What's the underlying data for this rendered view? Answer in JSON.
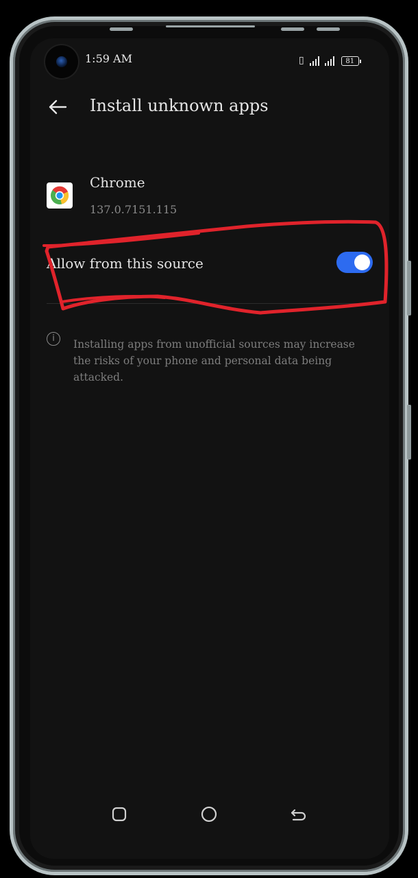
{
  "status_bar": {
    "time": "1:59 AM",
    "battery": "81"
  },
  "header": {
    "title": "Install unknown apps"
  },
  "app": {
    "name": "Chrome",
    "version": "137.0.7151.115"
  },
  "setting": {
    "label": "Allow from this source",
    "enabled": true
  },
  "info": {
    "text": "Installing apps from unofficial sources may increase the risks of your phone and personal data being attacked."
  },
  "icons": [
    "back-arrow-icon",
    "chrome-icon",
    "info-icon",
    "recents-icon",
    "home-icon",
    "back-nav-icon"
  ],
  "colors": {
    "accent": "#2d6bf0",
    "annotation": "#e0232b",
    "background": "#121212"
  }
}
